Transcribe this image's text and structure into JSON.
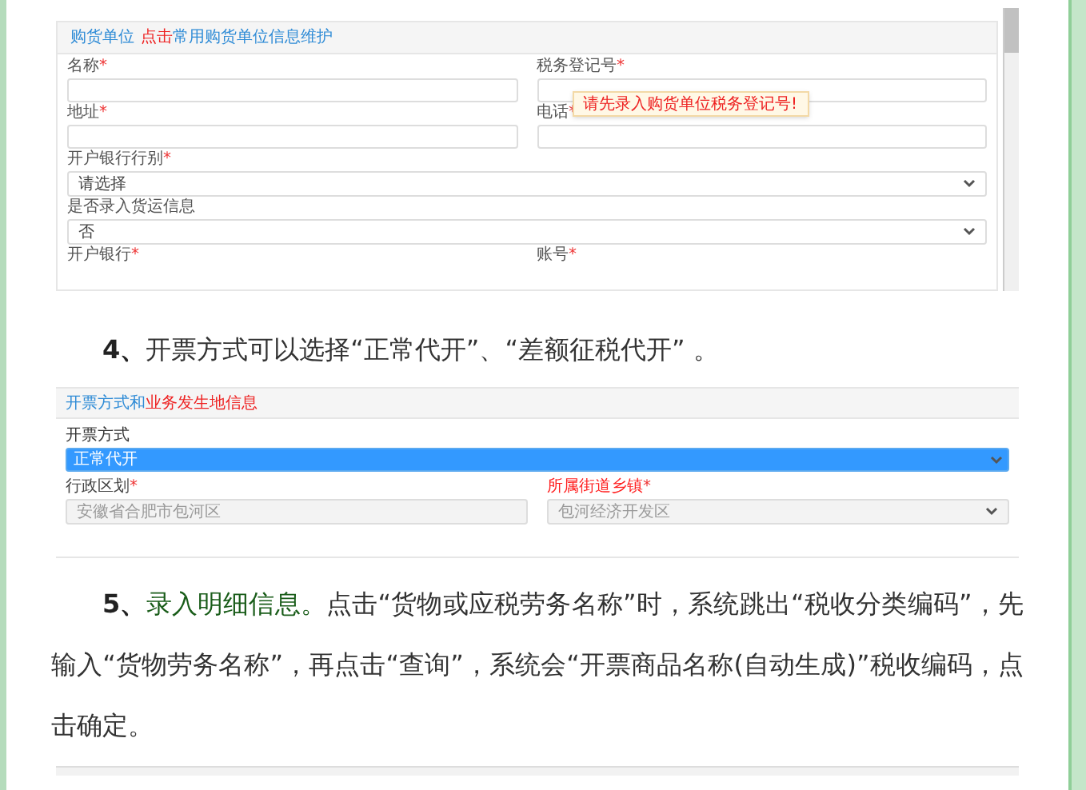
{
  "form1": {
    "header_title": "购货单位",
    "header_link": "点击",
    "header_text": "常用购货单位信息维护",
    "rows": [
      {
        "kind": "pair",
        "fields": [
          {
            "label": "名称",
            "mark": "*"
          },
          {
            "label": "税务登记号",
            "mark": "*"
          }
        ]
      },
      {
        "kind": "pair",
        "fields": [
          {
            "label": "地址",
            "mark": "*"
          },
          {
            "label": "电话",
            "mark": "*",
            "tooltip": "请先录入购货单位税务登记号!"
          }
        ]
      },
      {
        "kind": "select",
        "label": "开户银行行别",
        "mark": "*",
        "value": "请选择"
      },
      {
        "kind": "select",
        "label": "是否录入货运信息",
        "value": "否"
      },
      {
        "kind": "labels",
        "fields": [
          {
            "label": "开户银行",
            "mark": "*"
          },
          {
            "label": "账号",
            "mark": "*"
          }
        ]
      }
    ]
  },
  "paragraph_4": [
    {
      "kind": "number",
      "text": "4、"
    },
    {
      "kind": "plain",
      "text": "开票方式可以选择“正常代开”、“差额征税代开” 。"
    }
  ],
  "form2": {
    "header_title": "开票方式和",
    "header_text": "业务发生地信息",
    "method": {
      "label": "开票方式",
      "value": "正常代开",
      "selected": true
    },
    "fields": [
      {
        "label": "行政区划",
        "mark": "*",
        "color": "#444444",
        "value": "安徽省合肥市包河区",
        "kind": "input",
        "disabled": true
      },
      {
        "label": "所属街道乡镇",
        "mark": "*",
        "color": "#ff2020",
        "value": "包河经济开发区",
        "kind": "select",
        "disabled": true
      }
    ]
  },
  "paragraph_5": [
    {
      "kind": "number",
      "text": "5、"
    },
    {
      "kind": "highlight",
      "text": "录入明细信息。"
    },
    {
      "kind": "plain",
      "text": "点击“货物或应税劳务名称”时，系统跳出“税收分类编码”，先输入“货物劳务名称”，再点击“查询”，系统会“开票商品名称(自动生成)”税收编码，点击确定。"
    }
  ]
}
